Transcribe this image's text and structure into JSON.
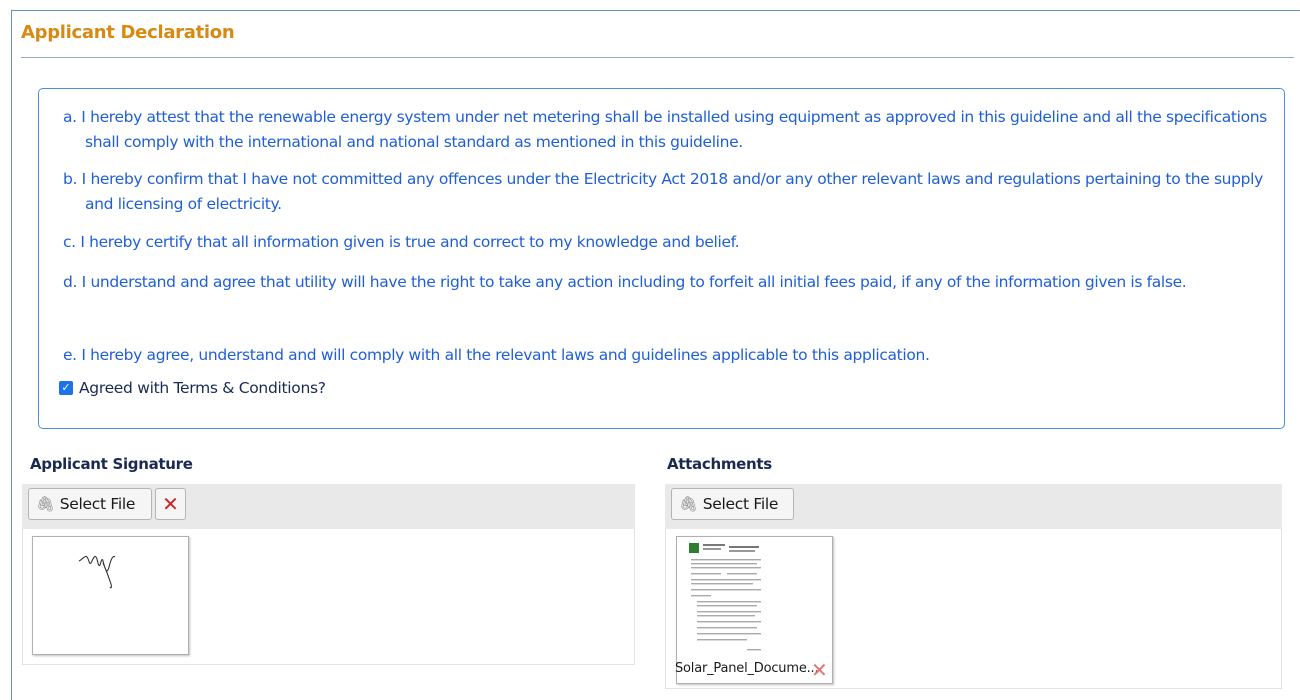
{
  "section": {
    "title": "Applicant Declaration"
  },
  "declaration": {
    "clauses": [
      "a. I hereby attest that the renewable energy system under net metering shall be installed using equipment as approved in this guideline and all the specifications shall comply with the international and national standard as mentioned in this guideline.",
      "b. I hereby confirm that I have not committed any offences under the Electricity Act 2018 and/or any other relevant laws and regulations pertaining to the supply and licensing of electricity.",
      "c. I hereby certify that all information given is true and correct to my knowledge and belief.",
      "d. I understand and agree that utility will have the right to take any action including to forfeit all initial fees paid, if any of the information given is false.",
      "e. I hereby agree, understand and will comply with all the relevant laws and guidelines applicable to this application."
    ],
    "agree_label": "Agreed with Terms & Conditions?",
    "agree_checked": true
  },
  "signature": {
    "label": "Applicant Signature",
    "select_label": "Select File",
    "remove_icon": "remove-x-icon"
  },
  "attachments": {
    "label": "Attachments",
    "select_label": "Select File",
    "files": [
      {
        "name": "Solar_Panel_Docume..."
      }
    ]
  },
  "colors": {
    "title": "#d68a14",
    "clause_text": "#1f5fd6",
    "border": "#4a90d9",
    "remove": "#c62828"
  }
}
